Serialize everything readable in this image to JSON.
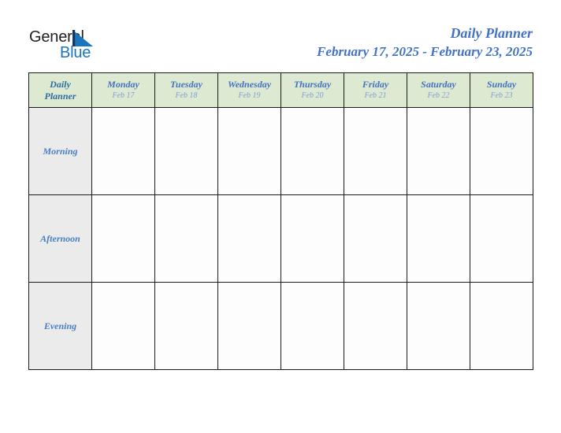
{
  "logo": {
    "word_dark": "General",
    "word_blue": "Blue",
    "triangle_icon": "triangle-icon",
    "dark_color": "#231f20",
    "blue_color": "#1b75bc"
  },
  "header": {
    "title": "Daily Planner",
    "date_range": "February 17, 2025 - February 23, 2025",
    "accent_color": "#4472c4"
  },
  "table": {
    "corner": {
      "line1": "Daily",
      "line2": "Planner"
    },
    "header_bg": "#dde9d0",
    "period_bg": "#ebebeb",
    "slot_bg": "#fdfdfd",
    "border_color": "#1a1a1a",
    "days": [
      {
        "name": "Monday",
        "date": "Feb 17"
      },
      {
        "name": "Tuesday",
        "date": "Feb 18"
      },
      {
        "name": "Wednesday",
        "date": "Feb 19"
      },
      {
        "name": "Thursday",
        "date": "Feb 20"
      },
      {
        "name": "Friday",
        "date": "Feb 21"
      },
      {
        "name": "Saturday",
        "date": "Feb 22"
      },
      {
        "name": "Sunday",
        "date": "Feb 23"
      }
    ],
    "periods": [
      {
        "label": "Morning",
        "entries": [
          "",
          "",
          "",
          "",
          "",
          "",
          ""
        ]
      },
      {
        "label": "Afternoon",
        "entries": [
          "",
          "",
          "",
          "",
          "",
          "",
          ""
        ]
      },
      {
        "label": "Evening",
        "entries": [
          "",
          "",
          "",
          "",
          "",
          "",
          ""
        ]
      }
    ]
  }
}
